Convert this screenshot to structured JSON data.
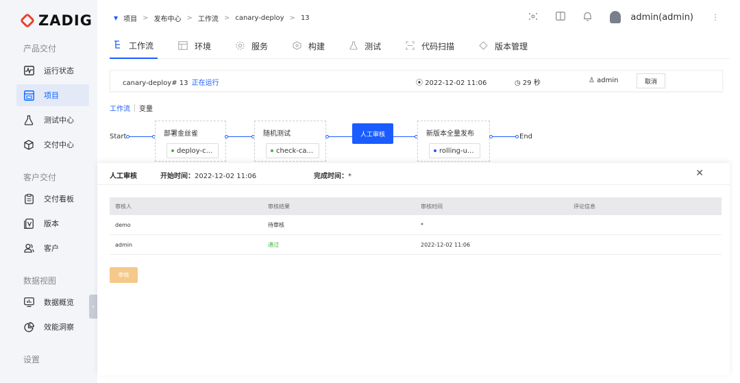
{
  "brand": {
    "name": "ZADIG",
    "accent": "#e8412e"
  },
  "sidebar": {
    "groups": [
      {
        "label": "产品交付",
        "items": [
          {
            "label": "运行状态",
            "icon": "pulse-icon"
          },
          {
            "label": "项目",
            "icon": "project-icon",
            "active": true
          },
          {
            "label": "测试中心",
            "icon": "flask-icon"
          },
          {
            "label": "交付中心",
            "icon": "package-icon"
          }
        ]
      },
      {
        "label": "客户交付",
        "items": [
          {
            "label": "交付看板",
            "icon": "clipboard-icon"
          },
          {
            "label": "版本",
            "icon": "version-icon"
          },
          {
            "label": "客户",
            "icon": "users-icon"
          }
        ]
      },
      {
        "label": "数据视图",
        "items": [
          {
            "label": "数据概览",
            "icon": "bar-chart-icon"
          },
          {
            "label": "效能洞察",
            "icon": "pie-chart-icon"
          }
        ]
      },
      {
        "label": "设置",
        "items": []
      }
    ]
  },
  "breadcrumb": [
    "项目",
    "发布中心",
    "工作流",
    "canary-deploy",
    "13"
  ],
  "user": {
    "name": "admin(admin)"
  },
  "tabs": [
    "工作流",
    "环境",
    "服务",
    "构建",
    "测试",
    "代码扫描",
    "版本管理"
  ],
  "run": {
    "name": "canary-deploy# 13",
    "status": "正在运行",
    "start_time": "2022-12-02 11:06",
    "duration": "29 秒",
    "creator": "admin",
    "cancel_label": "取消"
  },
  "subtabs": {
    "workflow": "工作流",
    "variables": "变量"
  },
  "pipeline": {
    "start": "Start",
    "end": "End",
    "stages": [
      {
        "title": "部署金丝雀",
        "job": "deploy-c..."
      },
      {
        "title": "随机测试",
        "job": "check-ca..."
      },
      {
        "title": "人工审核"
      },
      {
        "title": "新版本全量发布",
        "job": "rolling-u..."
      }
    ]
  },
  "panel": {
    "title": "人工审核",
    "start_label": "开始时间：",
    "start_value": "2022-12-02 11:06",
    "finish_label": "完成时间：",
    "finish_value": "*",
    "columns": [
      "审核人",
      "审核结果",
      "审核时间",
      "评论信息"
    ],
    "rows": [
      {
        "reviewer": "demo",
        "result": "待审核",
        "time": "*",
        "comment": ""
      },
      {
        "reviewer": "admin",
        "result": "通过",
        "time": "2022-12-02 11:06",
        "comment": ""
      }
    ],
    "approve_label": "审核"
  }
}
